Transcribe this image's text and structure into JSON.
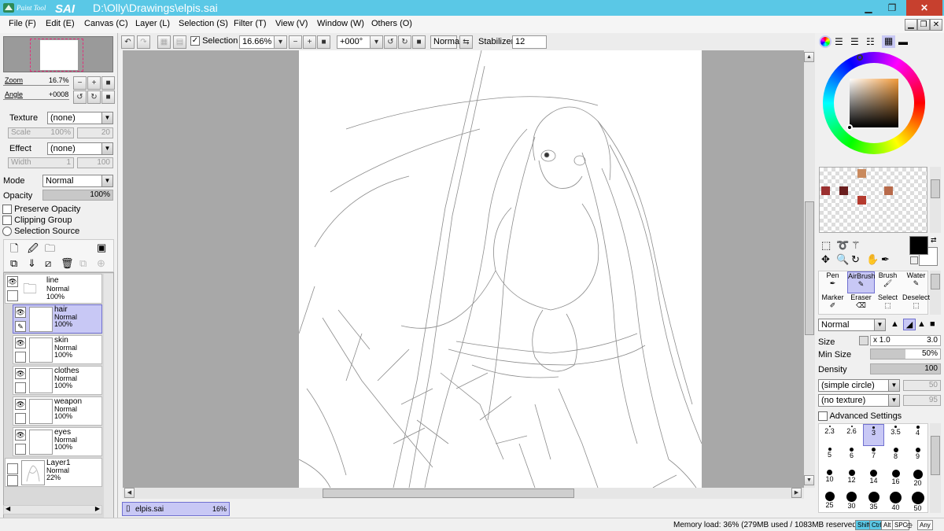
{
  "window": {
    "app_logo_text": "Paint Tool SAI",
    "file_path": "D:\\Olly\\Drawings\\elpis.sai",
    "controls": [
      "minimize-icon",
      "restore-icon",
      "close-icon"
    ]
  },
  "menu": [
    "File (F)",
    "Edit (E)",
    "Canvas (C)",
    "Layer (L)",
    "Selection (S)",
    "Filter (T)",
    "View (V)",
    "Window (W)",
    "Others (O)"
  ],
  "toolbar": {
    "selection_label": "Selection",
    "selection_checked": true,
    "zoom_value": "16.66%",
    "angle_value": "+000°",
    "blend_mode": "Normal",
    "stabilizer_label": "Stabilizer",
    "stabilizer_value": "12"
  },
  "navigator": {
    "zoom_label": "Zoom",
    "zoom_value": "16.7%",
    "angle_label": "Angle",
    "angle_value": "+0008"
  },
  "layer_props": {
    "texture_label": "Texture",
    "texture_value": "(none)",
    "scale_label": "Scale",
    "scale_value": "100%",
    "scale_num": "20",
    "effect_label": "Effect",
    "effect_value": "(none)",
    "width_label": "Width",
    "width_value": "1",
    "width_num": "100",
    "mode_label": "Mode",
    "mode_value": "Normal",
    "opacity_label": "Opacity",
    "opacity_value": "100%",
    "preserve_opacity": "Preserve Opacity",
    "clipping_group": "Clipping Group",
    "selection_source": "Selection Source"
  },
  "layers": [
    {
      "name": "line",
      "mode": "Normal",
      "opacity": "100%",
      "type": "folder",
      "selected": false
    },
    {
      "name": "hair",
      "mode": "Normal",
      "opacity": "100%",
      "type": "layer",
      "selected": true
    },
    {
      "name": "skin",
      "mode": "Normal",
      "opacity": "100%",
      "type": "layer",
      "selected": false
    },
    {
      "name": "clothes",
      "mode": "Normal",
      "opacity": "100%",
      "type": "layer",
      "selected": false
    },
    {
      "name": "weapon",
      "mode": "Normal",
      "opacity": "100%",
      "type": "layer",
      "selected": false
    },
    {
      "name": "eyes",
      "mode": "Normal",
      "opacity": "100%",
      "type": "layer",
      "selected": false
    },
    {
      "name": "Layer1",
      "mode": "Normal",
      "opacity": "22%",
      "type": "layer",
      "selected": false
    }
  ],
  "canvas_tab": {
    "name": "elpis.sai",
    "zoom": "16%"
  },
  "swatches": [
    "#c98a5e",
    "#9b3030",
    "#6a1e1e",
    "#b86a4a",
    "#b43a2e"
  ],
  "colors": {
    "primary": "#000000",
    "secondary": "#ffffff",
    "accent": "#5ac8e6",
    "selection": "#c8c8f5"
  },
  "tools": [
    {
      "label": "Pen",
      "selected": false
    },
    {
      "label": "AirBrush",
      "selected": true
    },
    {
      "label": "Brush",
      "selected": false
    },
    {
      "label": "Water",
      "selected": false
    },
    {
      "label": "Marker",
      "selected": false
    },
    {
      "label": "Eraser",
      "selected": false
    },
    {
      "label": "Select",
      "selected": false
    },
    {
      "label": "Deselect",
      "selected": false
    }
  ],
  "brush": {
    "mode": "Normal",
    "size_label": "Size",
    "size_mult": "x 1.0",
    "size_value": "3.0",
    "min_size_label": "Min Size",
    "min_size_value": "50%",
    "density_label": "Density",
    "density_value": "100",
    "shape_value": "(simple circle)",
    "shape_num": "50",
    "texture_value": "(no texture)",
    "texture_num": "95",
    "advanced_settings": "Advanced Settings"
  },
  "brush_sizes": [
    "2.3",
    "2.6",
    "3",
    "3.5",
    "4",
    "5",
    "6",
    "7",
    "8",
    "9",
    "10",
    "12",
    "14",
    "16",
    "20",
    "25",
    "30",
    "35",
    "40",
    "50"
  ],
  "brush_size_selected": "3",
  "status": {
    "memory": "Memory load: 36% (279MB used / 1083MB reserved)",
    "keys": [
      "Shift",
      "Ctrl",
      "Alt",
      "SPC",
      "Any"
    ]
  }
}
